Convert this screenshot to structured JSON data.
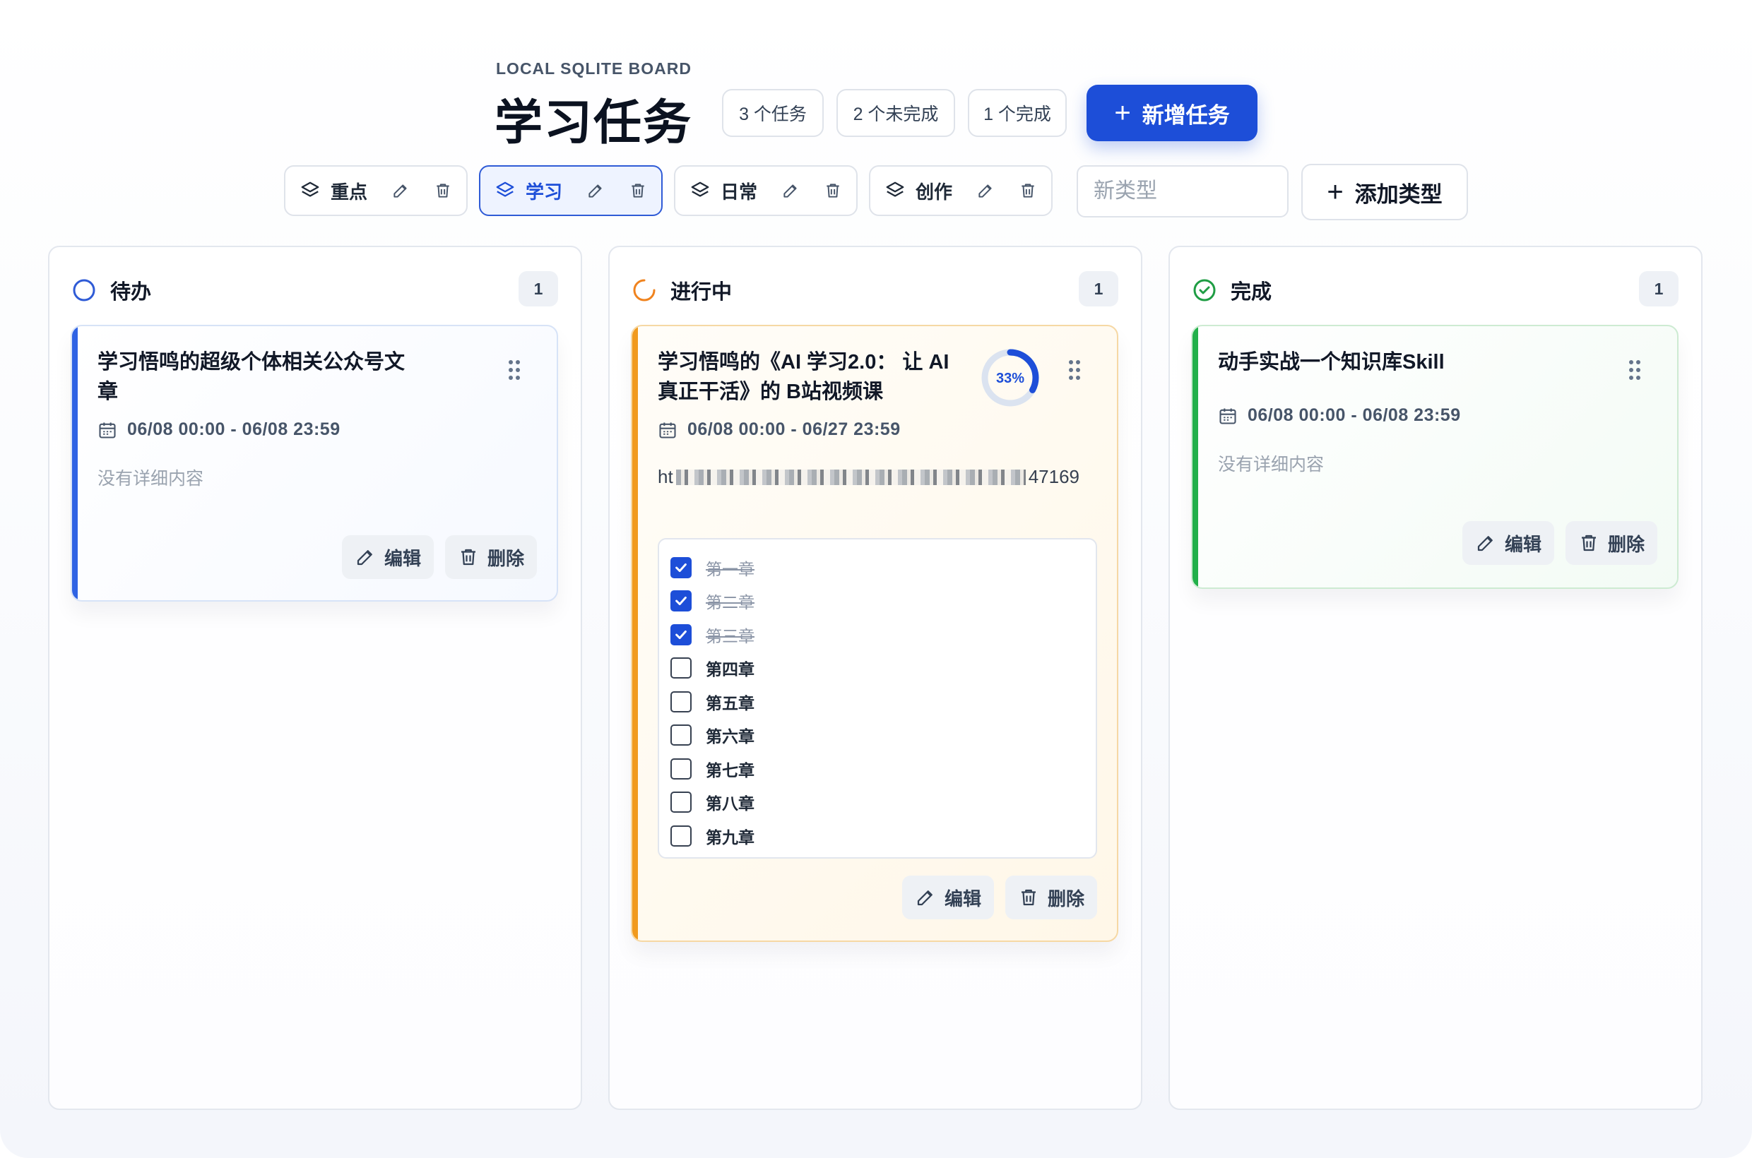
{
  "header": {
    "eyebrow": "LOCAL SQLITE BOARD",
    "title": "学习任务",
    "stats": [
      "3 个任务",
      "2 个未完成",
      "1 个完成"
    ],
    "new_task_label": "新增任务"
  },
  "categories": [
    {
      "label": "重点",
      "active": false
    },
    {
      "label": "学习",
      "active": true
    },
    {
      "label": "日常",
      "active": false
    },
    {
      "label": "创作",
      "active": false
    }
  ],
  "new_type": {
    "placeholder": "新类型",
    "value": "",
    "add_label": "添加类型"
  },
  "colors": {
    "primary": "#1d4ed8",
    "todo": "#2f63e4",
    "doing": "#f19a1e",
    "done": "#22b04a"
  },
  "columns": [
    {
      "title": "待办",
      "count": "1",
      "icon": "circle-icon",
      "cards": [
        {
          "title": "学习悟鸣的超级个体相关公众号文章",
          "date_range": "06/08 00:00 - 06/08 23:59",
          "description": "没有详细内容"
        }
      ]
    },
    {
      "title": "进行中",
      "count": "1",
      "icon": "progress-icon",
      "cards": [
        {
          "title": "学习悟鸣的《AI 学习2.0： 让 AI 真正干活》的 B站视频课",
          "date_range": "06/27 23:59",
          "date_range_full": "06/08 00:00 - 06/27 23:59",
          "progress": 0.33,
          "progress_label": "33%",
          "link_prefix": "ht",
          "link_suffix": "47169",
          "checklist": [
            {
              "label": "第一章",
              "done": true
            },
            {
              "label": "第二章",
              "done": true
            },
            {
              "label": "第三章",
              "done": true
            },
            {
              "label": "第四章",
              "done": false
            },
            {
              "label": "第五章",
              "done": false
            },
            {
              "label": "第六章",
              "done": false
            },
            {
              "label": "第七章",
              "done": false
            },
            {
              "label": "第八章",
              "done": false
            },
            {
              "label": "第九章",
              "done": false
            }
          ]
        }
      ]
    },
    {
      "title": "完成",
      "count": "1",
      "icon": "check-circle-icon",
      "cards": [
        {
          "title": "动手实战一个知识库Skill",
          "date_range": "06/08 00:00 - 06/08 23:59",
          "description": "没有详细内容"
        }
      ]
    }
  ],
  "actions": {
    "edit": "编辑",
    "delete": "删除"
  }
}
